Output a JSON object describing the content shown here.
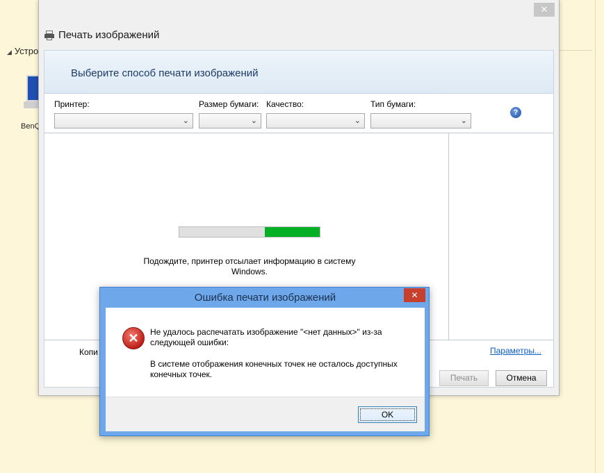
{
  "background": {
    "devices_label": "Устро",
    "device_label": "BenQ"
  },
  "window": {
    "title": "Печать изображений",
    "close_glyph": "✕",
    "banner_title": "Выберите способ печати изображений",
    "printer_label": "Принтер:",
    "paper_size_label": "Размер бумаги:",
    "quality_label": "Качество:",
    "paper_type_label": "Тип бумаги:",
    "help_glyph": "?",
    "progress_fraction_start": 0.61,
    "progress_fraction_end": 1.0,
    "wait_text_line1": "Подождите, принтер отсылает информацию в систему",
    "wait_text_line2": "Windows.",
    "copies_label": "Копи",
    "params_link": "Параметры...",
    "print_button": "Печать",
    "cancel_button": "Отмена",
    "progress_color": "#06b025"
  },
  "error_dialog": {
    "title": "Ошибка печати изображений",
    "close_glyph": "✕",
    "icon": "error-icon",
    "message_line1": "Не удалось распечатать изображение \"<нет данных>\" из-за",
    "message_line2": "следующей ошибки:",
    "detail_line1": "В системе отображения конечных точек не осталось доступных",
    "detail_line2": "конечных точек.",
    "ok_button": "OK"
  }
}
